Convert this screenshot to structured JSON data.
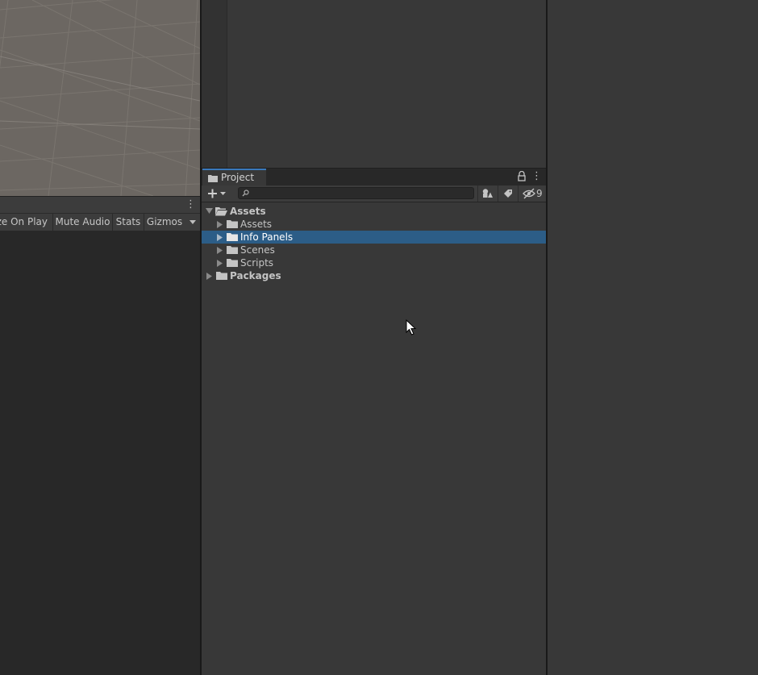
{
  "game_view": {
    "toolbar": {
      "maximize_label": "ze On Play",
      "mute_label": "Mute Audio",
      "stats_label": "Stats",
      "gizmos_label": "Gizmos"
    }
  },
  "project": {
    "tab_label": "Project",
    "search": {
      "placeholder": "",
      "value": ""
    },
    "hidden_packages_count": "9",
    "tree": {
      "assets_root": "Assets",
      "children": [
        "Assets",
        "Info Panels",
        "Scenes",
        "Scripts"
      ],
      "selected": "Info Panels",
      "packages_root": "Packages"
    }
  },
  "colors": {
    "selection": "#2c5d87",
    "tab_accent": "#3a79bb",
    "panel_bg": "#383838",
    "scene_bg": "#6b6661"
  },
  "icons": [
    "menu-dots-icon",
    "folder-icon",
    "lock-icon",
    "plus-icon",
    "search-icon",
    "filter-type-icon",
    "label-icon",
    "hidden-packages-icon",
    "arrow-cursor-icon"
  ]
}
